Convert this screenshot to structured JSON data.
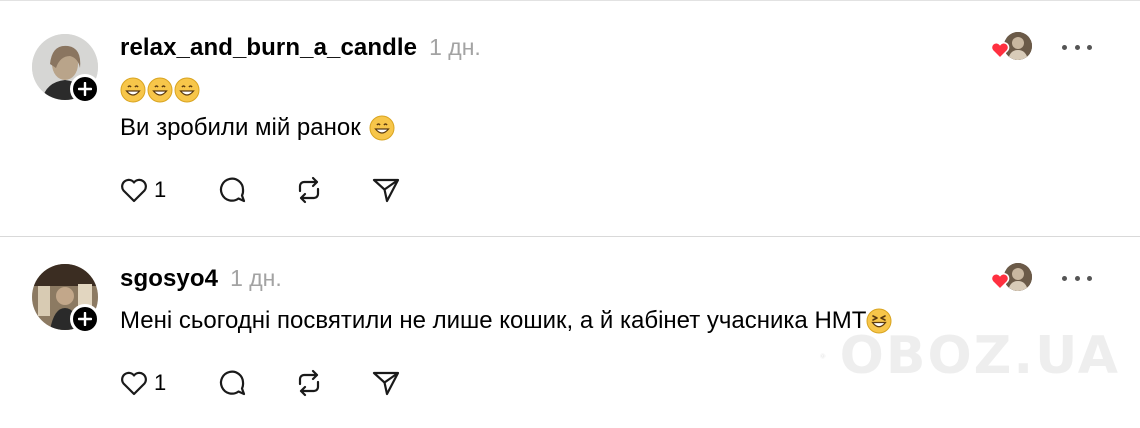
{
  "posts": [
    {
      "username": "relax_and_burn_a_candle",
      "time": "1 дн.",
      "emoji_line": "😁😁😁",
      "text": "Ви зробили мій ранок",
      "text_emoji": "😁",
      "likes": "1",
      "liked_by_author": true
    },
    {
      "username": "sgosyo4",
      "time": "1 дн.",
      "text": "Мені сьогодні посвятили не лише кошик, а й кабінет учасника НМТ",
      "text_emoji": "😆",
      "likes": "1",
      "liked_by_author": true
    }
  ],
  "watermark": {
    "text": "OBOZ.UA"
  },
  "icons": {
    "like": "heart-outline-icon",
    "reply": "comment-bubble-icon",
    "repost": "repost-icon",
    "share": "send-icon",
    "more": "more-dots-icon",
    "follow": "plus-icon"
  },
  "colors": {
    "heart": "#ff3040",
    "time": "#a3a3a3",
    "divider": "#d9d9d9"
  }
}
